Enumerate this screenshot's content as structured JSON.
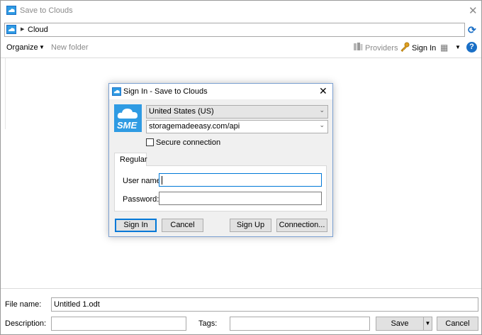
{
  "window": {
    "title": "Save to Clouds",
    "close_glyph": "✕"
  },
  "address": {
    "crumb": "Cloud",
    "chevron_glyph": "▶",
    "refresh_glyph": "⟳"
  },
  "toolbar": {
    "organize": "Organize",
    "organize_arrow": "▼",
    "new_folder": "New folder",
    "providers": "Providers",
    "sign_in": "Sign In",
    "view_glyph": "▦",
    "view_arrow": "▼",
    "help": "?"
  },
  "bottom": {
    "file_name_label": "File name:",
    "file_name_value": "Untitled 1.odt",
    "description_label": "Description:",
    "description_value": "",
    "tags_label": "Tags:",
    "tags_value": "",
    "save_label": "Save",
    "save_arrow": "▼",
    "cancel_label": "Cancel"
  },
  "dialog": {
    "title": "Sign In - Save to Clouds",
    "close_glyph": "✕",
    "logo_text": "SME",
    "region": "United States (US)",
    "endpoint": "storagemadeeasy.com/api",
    "select_arrow": "⌄",
    "secure_label": "Secure connection",
    "secure_checked": false,
    "tab_label": "Regular",
    "username_label": "User name:",
    "username_value": "",
    "password_label": "Password:",
    "password_value": "",
    "buttons": {
      "sign_in": "Sign In",
      "cancel": "Cancel",
      "sign_up": "Sign Up",
      "connection": "Connection..."
    }
  },
  "colors": {
    "accent": "#1a6fc6",
    "logo": "#2f9be3",
    "focus": "#0078d7"
  }
}
